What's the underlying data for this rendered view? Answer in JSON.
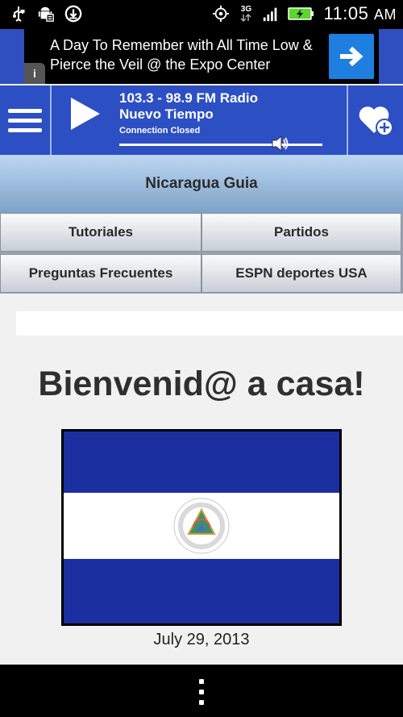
{
  "status_bar": {
    "time": "11:05",
    "ampm": "AM",
    "network": "3G",
    "left_icons": [
      "usb-icon",
      "android-debug-icon",
      "download-icon"
    ],
    "right_icons": [
      "gps-icon",
      "network-3g-icon",
      "signal-icon",
      "battery-charging-icon"
    ]
  },
  "ad": {
    "text": "A Day To Remember with All Time Low & Pierce the Veil @ the Expo Center",
    "info_label": "i"
  },
  "player": {
    "frequency": "103.3 - 98.9 FM Radio",
    "station_name": "Nuevo Tiempo",
    "status": "Connection Closed",
    "volume_level": 0.79
  },
  "title_band": {
    "title": "Nicaragua Guia"
  },
  "nav_buttons": [
    {
      "label": "Tutoriales"
    },
    {
      "label": "Partidos"
    },
    {
      "label": "Preguntas Frecuentes"
    },
    {
      "label": "ESPN deportes USA"
    }
  ],
  "content": {
    "heading": "Bienvenid@ a casa!",
    "image_alt": "Nicaragua flag",
    "date": "July 29, 2013"
  },
  "colors": {
    "player_bg": "#2d4fc4",
    "ad_arrow": "#1f7fe0",
    "flag_blue": "#1b2fa0",
    "flag_white": "#ffffff"
  }
}
